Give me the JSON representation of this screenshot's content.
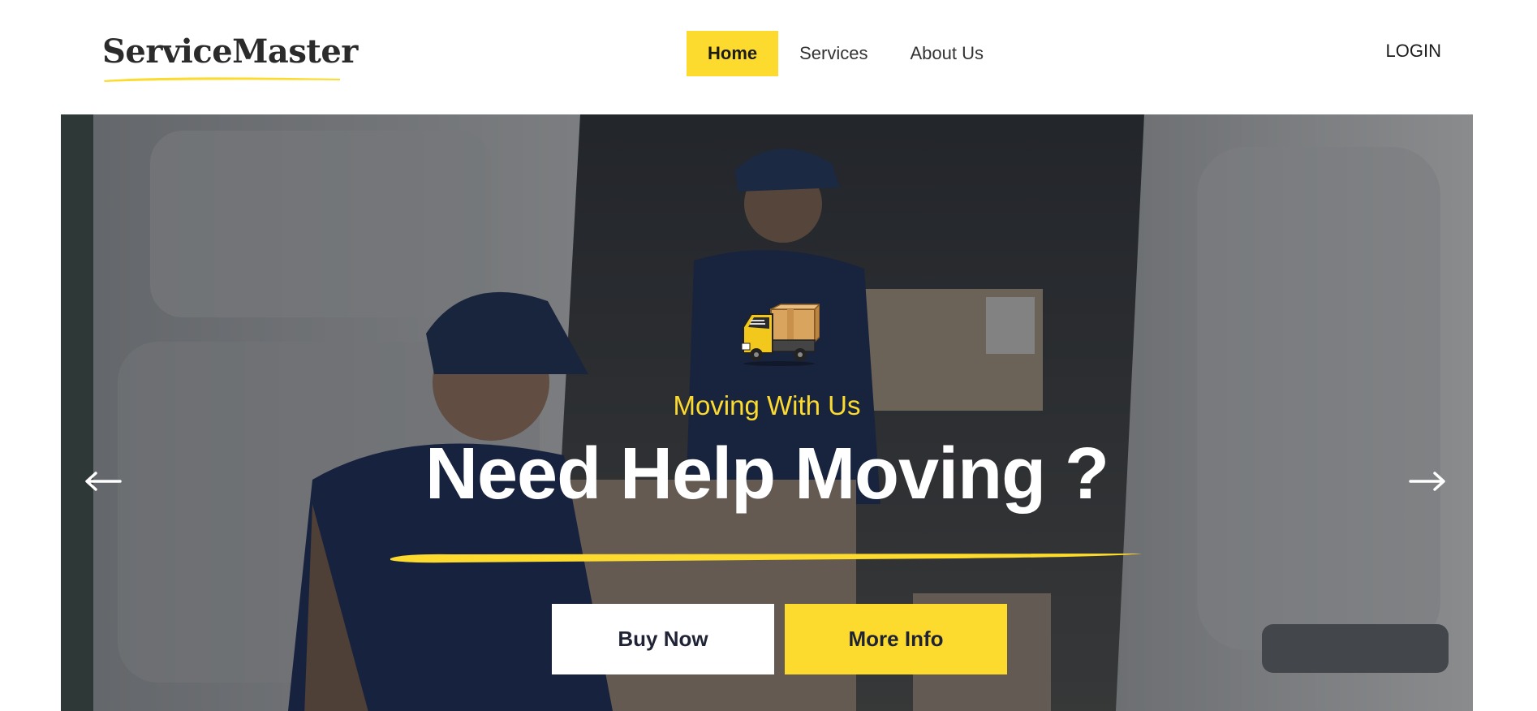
{
  "header": {
    "logo_text": "ServiceMaster",
    "nav": [
      {
        "label": "Home",
        "active": true
      },
      {
        "label": "Services",
        "active": false
      },
      {
        "label": "About Us",
        "active": false
      }
    ],
    "login_label": "LOGIN"
  },
  "hero": {
    "subtitle": "Moving With Us",
    "title": "Need Help Moving ?",
    "buy_label": "Buy Now",
    "more_label": "More Info",
    "prev_icon": "arrow-left-icon",
    "next_icon": "arrow-right-icon",
    "badge_icon": "delivery-truck-icon"
  },
  "colors": {
    "accent": "#fcdb2e",
    "dark_text": "#1f2333",
    "white": "#ffffff"
  }
}
